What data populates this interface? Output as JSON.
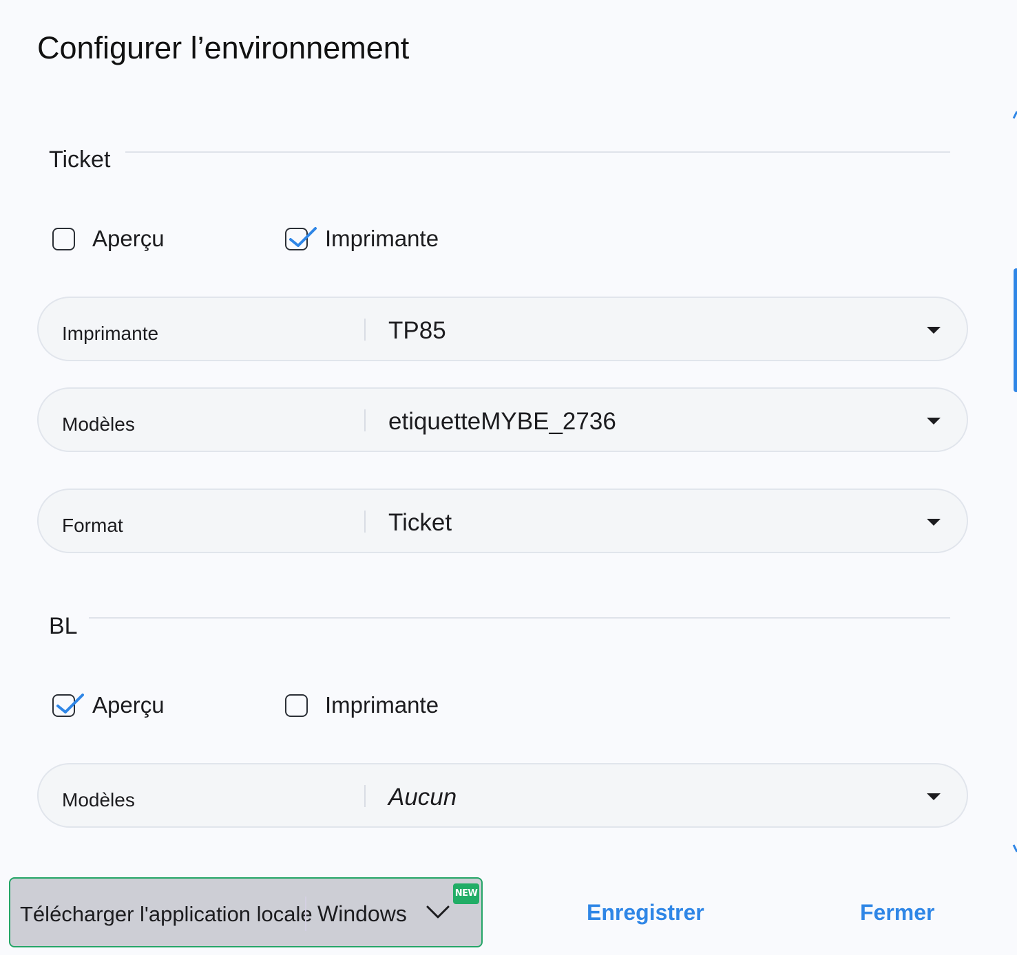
{
  "dialog": {
    "title": "Configurer l’environnement"
  },
  "ticket": {
    "section_title": "Ticket",
    "checkboxes": [
      {
        "label": "Aperçu",
        "checked": false
      },
      {
        "label": "Imprimante",
        "checked": true
      }
    ],
    "fields": [
      {
        "label": "Imprimante",
        "value": "TP85"
      },
      {
        "label": "Modèles",
        "value": "etiquetteMYBE_2736"
      },
      {
        "label": "Format",
        "value": "Ticket"
      }
    ]
  },
  "bl": {
    "section_title": "BL",
    "checkboxes": [
      {
        "label": "Aperçu",
        "checked": true
      },
      {
        "label": "Imprimante",
        "checked": false
      }
    ],
    "fields": [
      {
        "label": "Modèles",
        "value": "Aucun"
      }
    ]
  },
  "footer": {
    "download_label": "Télécharger l'application locale",
    "os_value": "Windows",
    "new_badge": "NEW",
    "save_label": "Enregistrer",
    "close_label": "Fermer"
  },
  "colors": {
    "accent": "#2f86e6",
    "badge_green": "#21ad66",
    "download_bg": "#cdced5",
    "page_bg": "#f9fafd"
  }
}
